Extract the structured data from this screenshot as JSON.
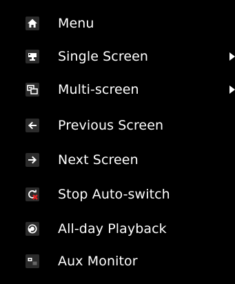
{
  "menu": {
    "items": [
      {
        "label": "Menu",
        "icon": "home-icon",
        "has_submenu": false
      },
      {
        "label": "Single Screen",
        "icon": "single-screen-icon",
        "has_submenu": true
      },
      {
        "label": "Multi-screen",
        "icon": "multi-screen-icon",
        "has_submenu": true
      },
      {
        "label": "Previous Screen",
        "icon": "arrow-left-icon",
        "has_submenu": false
      },
      {
        "label": "Next Screen",
        "icon": "arrow-right-icon",
        "has_submenu": false
      },
      {
        "label": "Stop Auto-switch",
        "icon": "stop-auto-switch-icon",
        "has_submenu": false
      },
      {
        "label": "All-day Playback",
        "icon": "playback-icon",
        "has_submenu": false
      },
      {
        "label": "Aux Monitor",
        "icon": "aux-monitor-icon",
        "has_submenu": false
      }
    ]
  },
  "colors": {
    "background": "#000000",
    "text": "#ffffff",
    "icon_background": "#2b2b2b",
    "stop_mark": "#e02020"
  }
}
